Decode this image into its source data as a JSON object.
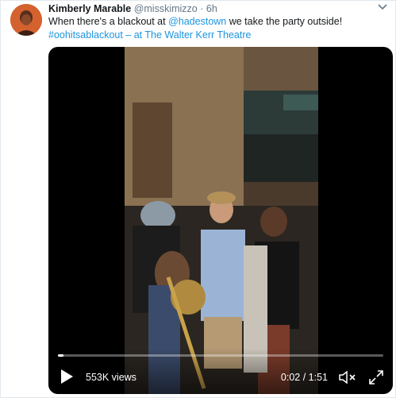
{
  "tweet": {
    "author_name": "Kimberly Marable",
    "author_handle": "@misskimizzo",
    "separator": "·",
    "timestamp": "6h",
    "text_before": "When there's a blackout at ",
    "mention": "@hadestown",
    "text_after": " we take the party outside!",
    "hashtag": "#oohitsablackout",
    "location_text": " – at The Walter Kerr Theatre",
    "menu_icon": "chevron-down-icon"
  },
  "video": {
    "views": "553K views",
    "timecode": "0:02 / 1:51",
    "progress": 0.018,
    "play_icon": "play-icon",
    "mute_icon": "muted-speaker-icon",
    "fullscreen_icon": "fullscreen-icon"
  },
  "colors": {
    "link": "#1b95e0",
    "text": "#14171a",
    "secondary": "#657786",
    "video_bg": "#000000"
  }
}
